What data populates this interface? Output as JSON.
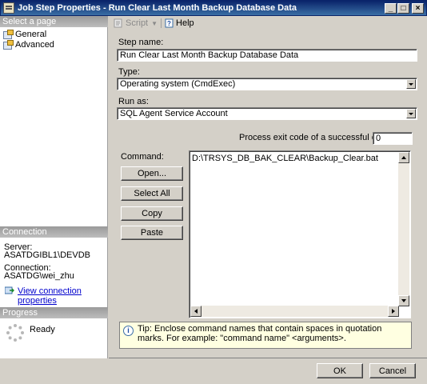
{
  "window": {
    "title": "Job Step Properties - Run Clear Last Month Backup Database Data"
  },
  "left": {
    "select_page_header": "Select a page",
    "pages": [
      {
        "label": "General"
      },
      {
        "label": "Advanced"
      }
    ],
    "connection_header": "Connection",
    "server_label": "Server:",
    "server_value": "ASATDGIBL1\\DEVDB",
    "connection_label": "Connection:",
    "connection_value": "ASATDG\\wei_zhu",
    "view_connection": "View connection properties",
    "progress_header": "Progress",
    "progress_status": "Ready"
  },
  "toolbar": {
    "script_label": "Script",
    "help_label": "Help"
  },
  "form": {
    "step_name_label": "Step name:",
    "step_name_value": "Run Clear Last Month Backup Database Data",
    "type_label": "Type:",
    "type_value": "Operating system (CmdExec)",
    "run_as_label": "Run as:",
    "run_as_value": "SQL Agent Service Account",
    "exit_code_label": "Process exit code of a successful command:",
    "exit_code_value": "0",
    "command_label": "Command:",
    "command_value": "D:\\TRSYS_DB_BAK_CLEAR\\Backup_Clear.bat",
    "open_button": "Open...",
    "select_all_button": "Select All",
    "copy_button": "Copy",
    "paste_button": "Paste",
    "tip_text": "Tip: Enclose command names that contain spaces in quotation marks. For example: \"command name\" <arguments>."
  },
  "footer": {
    "ok_button": "OK",
    "cancel_button": "Cancel"
  }
}
